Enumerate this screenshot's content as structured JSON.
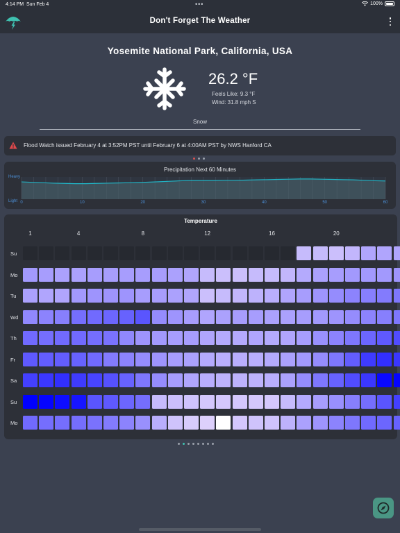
{
  "status_bar": {
    "time": "4:14 PM",
    "date": "Sun Feb 4",
    "battery": "100%"
  },
  "app_bar": {
    "title": "Don't Forget The Weather"
  },
  "current": {
    "location": "Yosemite National Park, California, USA",
    "temperature": "26.2 °F",
    "feels_like": "Feels Like: 9.3 °F",
    "wind": "Wind: 31.8 mph S",
    "condition": "Snow",
    "icon": "snowflake-icon"
  },
  "alert": {
    "text": "Flood Watch issued February 4 at 3:52PM PST until February 6 at 4:00AM PST by NWS Hanford CA",
    "icon": "warning-triangle-icon",
    "color": "#e0494b"
  },
  "precipitation": {
    "title": "Precipitation Next 60 Minutes",
    "y_labels": [
      "Heavy",
      "Light"
    ],
    "x_ticks": [
      "0",
      "10",
      "20",
      "30",
      "40",
      "50",
      "60"
    ],
    "line_color": "#21b3c4",
    "intensity": [
      0.78,
      0.76,
      0.74,
      0.72,
      0.71,
      0.7,
      0.7,
      0.71,
      0.72,
      0.73,
      0.74,
      0.75,
      0.77,
      0.79,
      0.81,
      0.83,
      0.84,
      0.84,
      0.84,
      0.85,
      0.85,
      0.86,
      0.87,
      0.88,
      0.89,
      0.9,
      0.91,
      0.91,
      0.9,
      0.89,
      0.88,
      0.87,
      0.85,
      0.83,
      0.82
    ]
  },
  "temperature_heatmap": {
    "title": "Temperature",
    "hour_labels": [
      {
        "hour": 1,
        "label": "1"
      },
      {
        "hour": 4,
        "label": "4"
      },
      {
        "hour": 8,
        "label": "8"
      },
      {
        "hour": 12,
        "label": "12"
      },
      {
        "hour": 16,
        "label": "16"
      },
      {
        "hour": 20,
        "label": "20"
      }
    ],
    "days": [
      "Su",
      "Mo",
      "Tu",
      "Wd",
      "Th",
      "Fr",
      "Sa",
      "Su",
      "Mo"
    ],
    "levels": [
      [
        -1,
        -1,
        -1,
        -1,
        -1,
        -1,
        -1,
        -1,
        -1,
        -1,
        -1,
        -1,
        -1,
        -1,
        -1,
        -1,
        -1,
        0.12,
        0.12,
        0.1,
        0.14,
        0.22,
        0.22,
        0.22
      ],
      [
        0.28,
        0.26,
        0.24,
        0.24,
        0.26,
        0.26,
        0.26,
        0.26,
        0.26,
        0.24,
        0.22,
        0.12,
        0.1,
        0.1,
        0.12,
        0.12,
        0.14,
        0.2,
        0.24,
        0.26,
        0.28,
        0.28,
        0.28,
        0.3
      ],
      [
        0.24,
        0.22,
        0.22,
        0.28,
        0.3,
        0.3,
        0.3,
        0.26,
        0.26,
        0.24,
        0.22,
        0.1,
        0.12,
        0.14,
        0.16,
        0.18,
        0.22,
        0.26,
        0.3,
        0.34,
        0.38,
        0.4,
        0.42,
        0.44
      ],
      [
        0.36,
        0.38,
        0.4,
        0.48,
        0.5,
        0.52,
        0.54,
        0.6,
        0.34,
        0.3,
        0.26,
        0.22,
        0.24,
        0.26,
        0.26,
        0.24,
        0.24,
        0.26,
        0.28,
        0.3,
        0.34,
        0.38,
        0.4,
        0.44
      ],
      [
        0.5,
        0.48,
        0.5,
        0.5,
        0.48,
        0.46,
        0.36,
        0.3,
        0.28,
        0.26,
        0.26,
        0.22,
        0.2,
        0.2,
        0.22,
        0.2,
        0.22,
        0.26,
        0.32,
        0.38,
        0.44,
        0.52,
        0.58,
        0.64
      ],
      [
        0.58,
        0.56,
        0.56,
        0.54,
        0.5,
        0.42,
        0.38,
        0.34,
        0.3,
        0.26,
        0.24,
        0.2,
        0.18,
        0.18,
        0.18,
        0.2,
        0.24,
        0.28,
        0.34,
        0.44,
        0.56,
        0.72,
        0.78,
        0.74
      ],
      [
        0.7,
        0.74,
        0.78,
        0.72,
        0.68,
        0.62,
        0.54,
        0.44,
        0.34,
        0.26,
        0.22,
        0.18,
        0.16,
        0.16,
        0.16,
        0.18,
        0.24,
        0.34,
        0.44,
        0.54,
        0.64,
        0.74,
        0.96,
        0.98
      ],
      [
        1.0,
        0.98,
        0.94,
        0.9,
        0.6,
        0.58,
        0.52,
        0.48,
        0.12,
        0.1,
        0.08,
        0.06,
        0.06,
        0.06,
        0.06,
        0.06,
        0.12,
        0.2,
        0.26,
        0.32,
        0.4,
        0.48,
        0.6,
        0.7
      ],
      [
        0.5,
        0.48,
        0.48,
        0.48,
        0.46,
        0.42,
        0.38,
        0.32,
        0.18,
        0.08,
        0.04,
        0.02,
        0.0,
        0.06,
        0.08,
        0.08,
        0.16,
        0.24,
        0.3,
        0.38,
        0.44,
        0.5,
        0.52,
        0.54
      ]
    ]
  },
  "pager_top": {
    "count": 3,
    "active": 0,
    "active_color": "#d9534f"
  },
  "pager_bottom": {
    "count": 8,
    "active": 1,
    "active_color": "#3fc1b0"
  },
  "fab": {
    "icon": "compass-icon"
  }
}
